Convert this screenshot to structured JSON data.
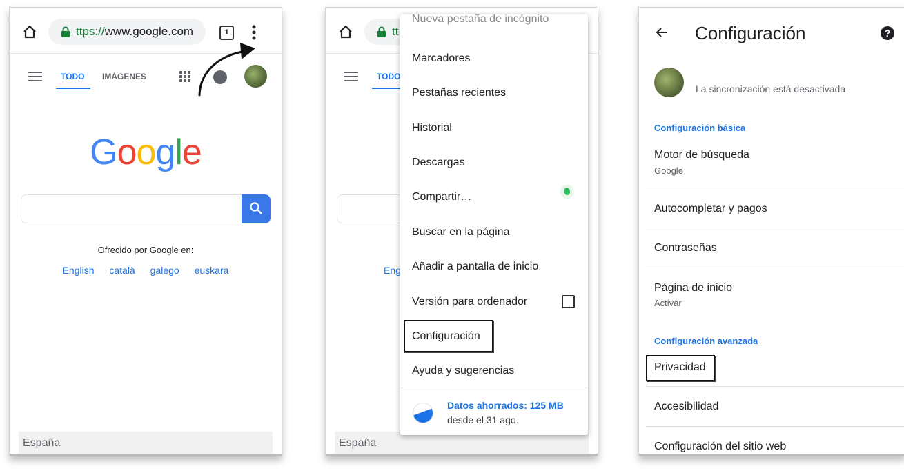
{
  "browser": {
    "url_scheme": "ttps://",
    "url_host": "www.google.com",
    "url_scheme_short": "tt",
    "tab_count": "1"
  },
  "google": {
    "tab_all": "TODO",
    "tab_images": "IMÁGENES",
    "logo": [
      "G",
      "o",
      "o",
      "g",
      "l",
      "e"
    ],
    "offered_by": "Ofrecido por Google en:",
    "languages": [
      "English",
      "català",
      "galego",
      "euskara"
    ],
    "footer": "España",
    "partial_lang": "Engl"
  },
  "menu": {
    "partial_item": "Nueva pestaña de incógnito",
    "items": [
      "Marcadores",
      "Pestañas recientes",
      "Historial",
      "Descargas",
      "Compartir…",
      "Buscar en la página",
      "Añadir a pantalla de inicio",
      "Versión para ordenador",
      "Configuración",
      "Ayuda y sugerencias"
    ],
    "savings_title": "Datos ahorrados: 125 MB",
    "savings_sub": "desde el 31 ago."
  },
  "settings": {
    "title": "Configuración",
    "sync": "La sincronización está desactivada",
    "section_basic": "Configuración básica",
    "search_engine": "Motor de búsqueda",
    "search_engine_value": "Google",
    "autofill": "Autocompletar y pagos",
    "passwords": "Contraseñas",
    "homepage": "Página de inicio",
    "homepage_value": "Activar",
    "section_advanced": "Configuración avanzada",
    "privacy": "Privacidad",
    "accessibility": "Accesibilidad",
    "site_settings": "Configuración del sitio web"
  },
  "colors": {
    "accent": "#1a73e8",
    "logo": [
      "#4285f4",
      "#ea4335",
      "#fbbc05",
      "#4285f4",
      "#34a853",
      "#ea4335"
    ]
  }
}
